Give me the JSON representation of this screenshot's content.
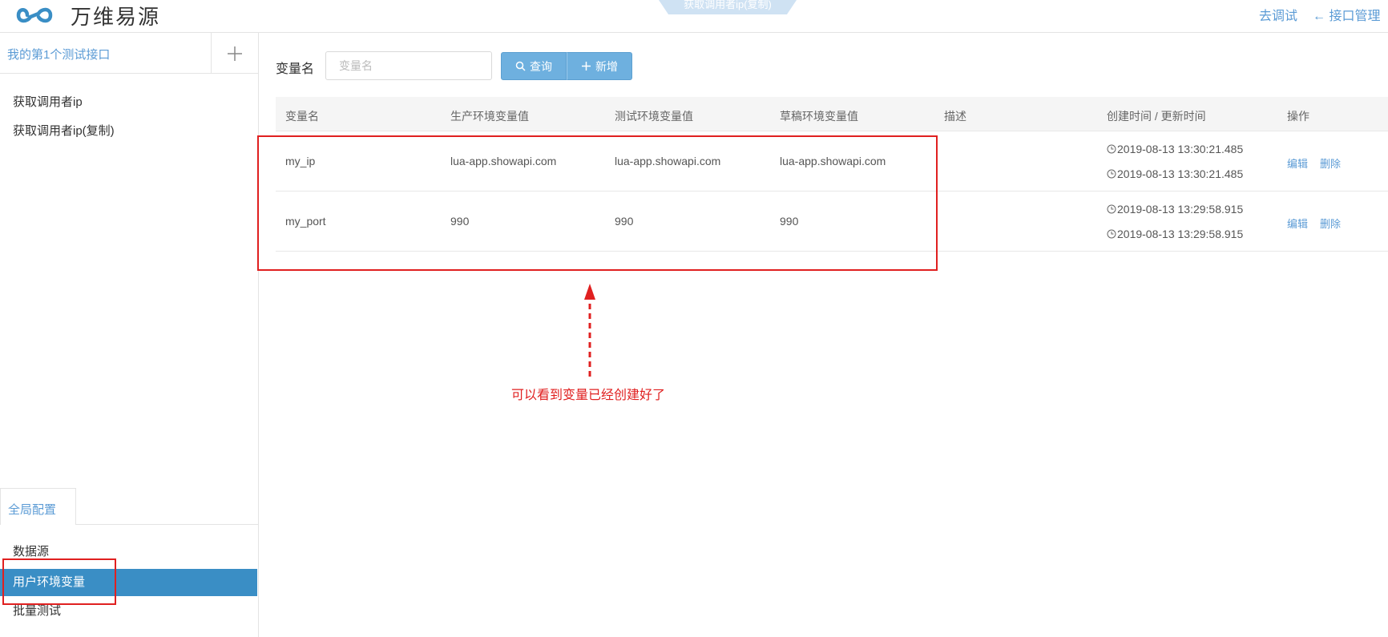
{
  "header": {
    "brand": "万维易源",
    "tab_title": "获取调用者ip(复制)",
    "debug_link": "去调试",
    "manage_link": "← 接口管理"
  },
  "sidebar": {
    "title": "我的第1个测试接口",
    "apis": [
      "获取调用者ip",
      "获取调用者ip(复制)"
    ],
    "global_tab": "全局配置",
    "nav": [
      "数据源",
      "用户环境变量",
      "批量测试"
    ],
    "active_nav": "用户环境变量"
  },
  "search": {
    "label": "变量名",
    "placeholder": "变量名",
    "query_button": "查询",
    "add_button": "新增"
  },
  "table": {
    "headers": [
      "变量名",
      "生产环境变量值",
      "测试环境变量值",
      "草稿环境变量值",
      "描述",
      "创建时间 / 更新时间",
      "操作"
    ],
    "rows": [
      {
        "name": "my_ip",
        "prod": "lua-app.showapi.com",
        "test": "lua-app.showapi.com",
        "draft": "lua-app.showapi.com",
        "desc": "",
        "created": "2019-08-13 13:30:21.485",
        "updated": "2019-08-13 13:30:21.485",
        "edit": "编辑",
        "delete": "删除"
      },
      {
        "name": "my_port",
        "prod": "990",
        "test": "990",
        "draft": "990",
        "desc": "",
        "created": "2019-08-13 13:29:58.915",
        "updated": "2019-08-13 13:29:58.915",
        "edit": "编辑",
        "delete": "删除"
      }
    ]
  },
  "annotation": {
    "note": "可以看到变量已经创建好了",
    "color": "#e02020"
  },
  "colors": {
    "accent": "#5b9bd5",
    "active_nav": "#3a8ec5",
    "button": "#6eb0df"
  }
}
